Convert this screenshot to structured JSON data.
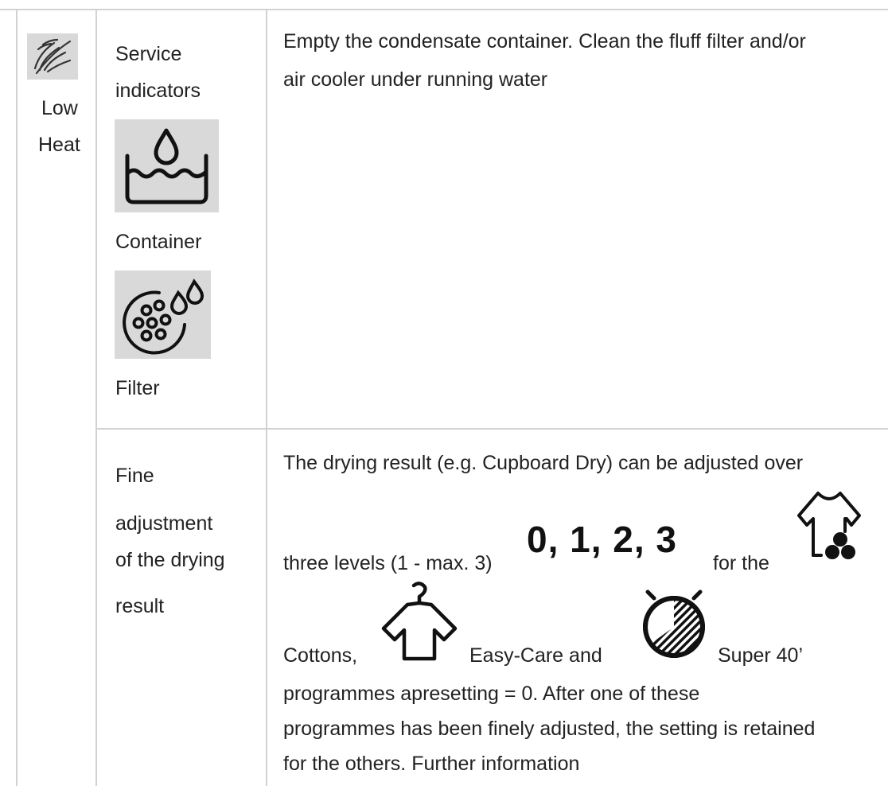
{
  "row1": {
    "mode_icon": "feather-low-heat-icon",
    "mode_label_line1": "Low",
    "mode_label_line2": "Heat",
    "indicators_line1": "Service",
    "indicators_line2": "indicators",
    "container_icon": "container-water-icon",
    "container_label": "Container",
    "filter_icon": "filter-drops-icon",
    "filter_label": "Filter",
    "description_line1": "Empty the condensate container. Clean the fluff filter and/or",
    "description_line2": "air cooler under running water"
  },
  "row2": {
    "label_line1": "Fine",
    "label_line2": "adjustment",
    "label_line3": "of the drying",
    "label_line4": "result",
    "line1": "The drying result (e.g. Cupboard Dry) can be adjusted over",
    "line2_pre": "three levels (1 - max. 3)",
    "levels": "0, 1, 2, 3",
    "line2_post": "for the",
    "cottons_icon": "shirt-cottons-icon",
    "cottons_label": "Cottons,",
    "easycare_icon": "shirt-hanger-icon",
    "easycare_label": "Easy-Care and",
    "super_icon": "stopwatch-icon",
    "super_label": "Super 40’",
    "line5": "programmes apresetting = 0. After one of these",
    "line6": "programmes has been finely adjusted, the setting is retained",
    "line7": "for the others. Further information"
  }
}
